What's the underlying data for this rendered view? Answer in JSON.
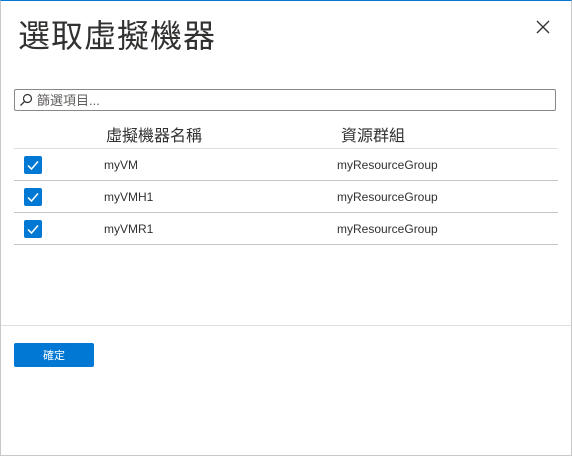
{
  "dialog": {
    "title": "選取虛擬機器",
    "close_icon": "close-icon"
  },
  "filter": {
    "value": "",
    "placeholder": "篩選項目...",
    "icon": "search-icon"
  },
  "table": {
    "columns": [
      "虛擬機器名稱",
      "資源群組"
    ],
    "rows": [
      {
        "checked": true,
        "name": "myVM",
        "resource_group": "myResourceGroup"
      },
      {
        "checked": true,
        "name": "myVMH1",
        "resource_group": "myResourceGroup"
      },
      {
        "checked": true,
        "name": "myVMR1",
        "resource_group": "myResourceGroup"
      }
    ]
  },
  "footer": {
    "ok_label": "確定"
  },
  "colors": {
    "accent": "#0078d4",
    "border": "#8a8886",
    "text": "#323130"
  }
}
